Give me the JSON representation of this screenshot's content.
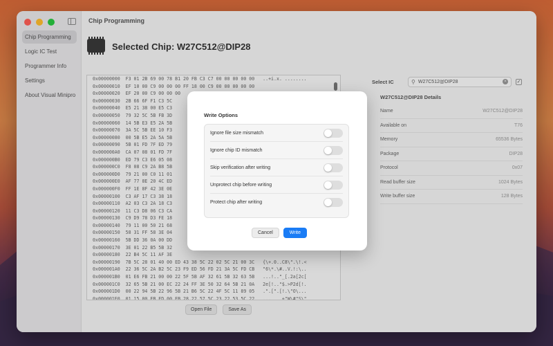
{
  "app": {
    "title": "Chip Programming",
    "selected_chip": "Selected Chip: W27C512@DIP28"
  },
  "sidebar": {
    "items": [
      {
        "label": "Chip Programming",
        "active": true
      },
      {
        "label": "Logic IC Test",
        "active": false
      },
      {
        "label": "Programmer Info",
        "active": false
      },
      {
        "label": "Settings",
        "active": false
      },
      {
        "label": "About Visual Minipro",
        "active": false
      }
    ]
  },
  "hex_view": {
    "rows": [
      "0x00000000  F3 01 2B 69 00 78 B1 20 FB C3 C7 00 00 00 00 00   ..+i.x. ........",
      "0x00000010  EF 10 00 C9 00 00 00 FF 18 00 C9 00 00 00 00 00",
      "0x00000020  EF 20 00 C9 00 00 00",
      "0x00000030  2B 66 6F F1 C3 5C",
      "0x00000040  E5 21 38 00 E5 C3",
      "0x00000050  79 32 5C 5B FB 3D",
      "0x00000060  14 5B E3 E5 2A 5B",
      "0x00000070  3A 5C 5B EE 10 F3",
      "0x00000080  00 5B E5 2A 5A 5B",
      "0x00000090  5B 01 FD 7F ED 79",
      "0x000000A0  CA 07 08 01 FD 7F",
      "0x000000B0  ED 79 C3 E6 05 08",
      "0x000000C0  F8 08 C9 2A B8 5B",
      "0x000000D0  79 21 00 C0 11 01",
      "0x000000E0  AF 77 8E 20 4C ED",
      "0x000000F0  FF 1E 8F 42 3E 0E",
      "0x00000100  C3 AF 17 C3 38 18",
      "0x00000110  A2 03 C3 2A 18 C3",
      "0x00000120  11 C3 D8 06 C3 CA",
      "0x00000130  C9 D9 78 D3 FE 18",
      "0x00000140  79 11 00 50 21 68",
      "0x00000150  58 31 FF 58 3E 04",
      "0x00000160  5B DD 36 0A 00 DD",
      "0x00000170  3E 01 22 B5 5B 32",
      "0x00000180  22 B4 5C 11 AF 3E",
      "0x00000190  7B 5C 28 01 40 00 ED 43 38 5C 22 02 5C 21 00 3C   {\\+.0..C8\\\".\\!.<",
      "0x000001A0  22 36 5C 2A B2 5C 23 F9 ED 56 FD 21 3A 5C FD CB   \"6\\*.\\#..V.!:\\..",
      "0x000001B0  01 E6 FB 21 00 00 22 5F 5B AF 32 61 5B 32 63 5B   ...!..\"_[.2a[2c[",
      "0x000001C0  32 65 5B 21 00 EC 22 24 FF 3E 50 32 64 5B 21 0A   2e[!..\"$.>P2d[!.",
      "0x000001D0  00 22 94 5B 22 96 5B 21 B6 5C 22 4F 5C 11 89 05   .\".[\".[!.\\\"O\\...",
      "0x000001E0  01 15 00 EB ED 00 EB 28 22 57 5C 23 22 53 5C 22   .......+\"W\\#\"S\\\""
    ],
    "open_file_label": "Open File",
    "save_as_label": "Save As"
  },
  "select_ic": {
    "label": "Select IC",
    "search_value": "W27C512@DIP28"
  },
  "details": {
    "title": "W27C512@DIP28 Details",
    "rows": [
      {
        "key": "Name",
        "value": "W27C512@DIP28"
      },
      {
        "key": "Available on",
        "value": "T76"
      },
      {
        "key": "Memory",
        "value": "65536 Bytes"
      },
      {
        "key": "Package",
        "value": "DIP28"
      },
      {
        "key": "Protocol",
        "value": "0x07"
      },
      {
        "key": "Read buffer size",
        "value": "1024 Bytes"
      },
      {
        "key": "Write buffer size",
        "value": "128 Bytes"
      }
    ]
  },
  "dialog": {
    "title": "Write Options",
    "options": [
      {
        "label": "Ignore file size mismatch",
        "enabled": false
      },
      {
        "label": "Ignore chip ID mismatch",
        "enabled": false
      },
      {
        "label": "Skip verification after writing",
        "enabled": false
      },
      {
        "label": "Unprotect chip before writing",
        "enabled": false
      },
      {
        "label": "Protect chip after writing",
        "enabled": false
      }
    ],
    "cancel_label": "Cancel",
    "write_label": "Write"
  },
  "colors": {
    "accent": "#1a7cf5",
    "toggle_off": "#dedede"
  }
}
